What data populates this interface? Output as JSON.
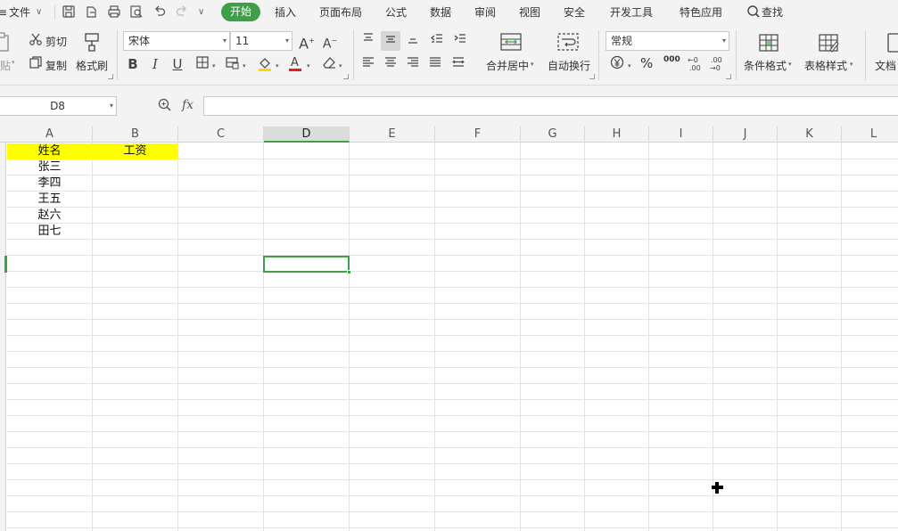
{
  "menubar": {
    "file_label": "文件",
    "tabs": [
      "开始",
      "插入",
      "页面布局",
      "公式",
      "数据",
      "审阅",
      "视图",
      "安全",
      "开发工具",
      "特色应用"
    ],
    "search_label": "查找"
  },
  "ribbon": {
    "paste_label": "贴",
    "cut_label": "剪切",
    "copy_label": "复制",
    "format_painter_label": "格式刷",
    "font_name": "宋体",
    "font_size": "11",
    "merge_center_label": "合并居中",
    "wrap_text_label": "自动换行",
    "number_format": "常规",
    "percent_glyph": "%",
    "thousands_glyph": "000",
    "conditional_format_label": "条件格式",
    "table_style_label": "表格样式",
    "doc_assistant_label": "文档"
  },
  "formula_bar": {
    "name_box": "D8",
    "fx_label": "fx",
    "content": ""
  },
  "sheet": {
    "columns": [
      "A",
      "B",
      "C",
      "D",
      "E",
      "F",
      "G",
      "H",
      "I",
      "J",
      "K",
      "L"
    ],
    "active_column": "D",
    "active_cell": "D8",
    "header_row": {
      "A": "姓名",
      "B": "工资"
    },
    "names": [
      "张三",
      "李四",
      "王五",
      "赵六",
      "田七"
    ],
    "header_fill": "#ffff00",
    "accent": "#3f9f48"
  }
}
